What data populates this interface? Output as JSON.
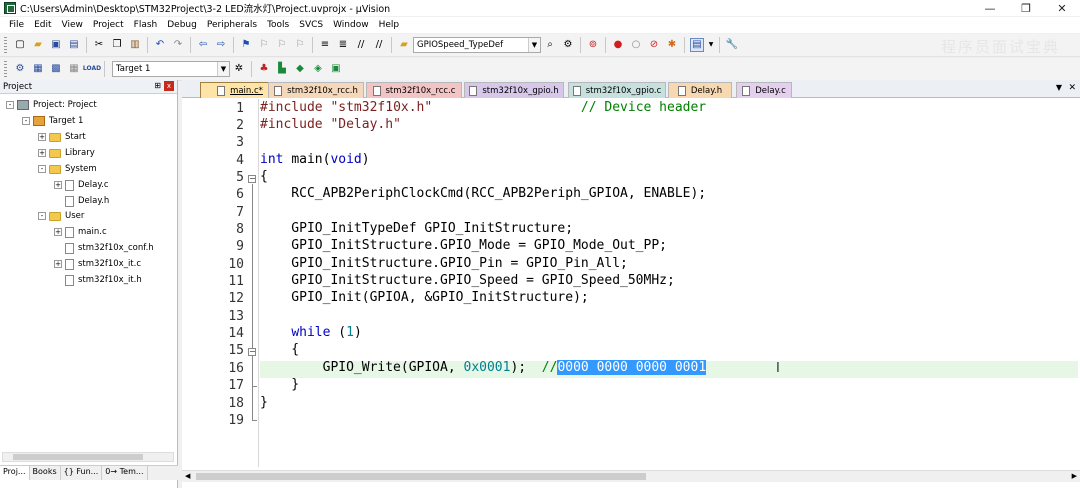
{
  "window": {
    "title": "C:\\Users\\Admin\\Desktop\\STM32Project\\3-2 LED流水灯\\Project.uvprojx - µVision",
    "minimize": "—",
    "restore": "❐",
    "close": "✕"
  },
  "menu": [
    "File",
    "Edit",
    "View",
    "Project",
    "Flash",
    "Debug",
    "Peripherals",
    "Tools",
    "SVCS",
    "Window",
    "Help"
  ],
  "toolbar1": {
    "find_combo": "GPIOSpeed_TypeDef",
    "icons": [
      "new-file-icon",
      "open-icon",
      "save-icon",
      "save-all-icon",
      "cut-icon",
      "copy-icon",
      "paste-icon",
      "undo-icon",
      "redo-icon",
      "nav-back-icon",
      "nav-forward-icon",
      "bookmark-icon",
      "bookmark-prev-icon",
      "bookmark-next-icon",
      "bookmark-clear-icon",
      "indent-icon",
      "unindent-icon",
      "comment-icon",
      "uncomment-icon",
      "find-in-files-icon",
      "debug-icon",
      "breakpoint-icon",
      "breakpoint-disable-icon",
      "breakpoint-disable-all-icon",
      "breakpoint-kill-all-icon",
      "window-layout-icon",
      "configure-icon"
    ]
  },
  "toolbar2": {
    "target_combo": "Target 1",
    "load_label": "LOAD"
  },
  "watermark": "程序员面试宝典",
  "project_panel": {
    "title": "Project",
    "pin": "📌",
    "close": "x",
    "tree": [
      {
        "label": "Project: Project",
        "level": 0,
        "type": "project",
        "expander": "-"
      },
      {
        "label": "Target 1",
        "level": 1,
        "type": "target",
        "expander": "-"
      },
      {
        "label": "Start",
        "level": 2,
        "type": "folder",
        "expander": "+"
      },
      {
        "label": "Library",
        "level": 2,
        "type": "folder",
        "expander": "+"
      },
      {
        "label": "System",
        "level": 2,
        "type": "folder",
        "expander": "-"
      },
      {
        "label": "Delay.c",
        "level": 3,
        "type": "file",
        "expander": "+"
      },
      {
        "label": "Delay.h",
        "level": 3,
        "type": "file",
        "expander": ""
      },
      {
        "label": "User",
        "level": 2,
        "type": "folder",
        "expander": "-"
      },
      {
        "label": "main.c",
        "level": 3,
        "type": "file",
        "expander": "+"
      },
      {
        "label": "stm32f10x_conf.h",
        "level": 3,
        "type": "file",
        "expander": ""
      },
      {
        "label": "stm32f10x_it.c",
        "level": 3,
        "type": "file",
        "expander": "+"
      },
      {
        "label": "stm32f10x_it.h",
        "level": 3,
        "type": "file",
        "expander": ""
      }
    ],
    "bottom_tabs": [
      "Proj...",
      "Books",
      "{} Fun...",
      "0→ Tem..."
    ]
  },
  "editor": {
    "tabs": [
      {
        "label": "main.c*",
        "color": "#ffe4a8",
        "active": true
      },
      {
        "label": "stm32f10x_rcc.h",
        "color": "#f5d7b9",
        "active": false
      },
      {
        "label": "stm32f10x_rcc.c",
        "color": "#f2c4c4",
        "active": false
      },
      {
        "label": "stm32f10x_gpio.h",
        "color": "#d7c7ea",
        "active": false
      },
      {
        "label": "stm32f10x_gpio.c",
        "color": "#c6e0dd",
        "active": false
      },
      {
        "label": "Delay.h",
        "color": "#f7d8b0",
        "active": false
      },
      {
        "label": "Delay.c",
        "color": "#e4d0ee",
        "active": false
      }
    ],
    "tab_menu": "▼",
    "tab_close": "✕",
    "line_numbers": [
      "1",
      "2",
      "3",
      "4",
      "5",
      "6",
      "7",
      "8",
      "9",
      "10",
      "11",
      "12",
      "13",
      "14",
      "15",
      "16",
      "17",
      "18",
      "19"
    ],
    "code": {
      "l1a": "#include ",
      "l1b": "\"stm32f10x.h\"",
      "l1c": "                   // Device header",
      "l2a": "#include ",
      "l2b": "\"Delay.h\"",
      "l4a": "int ",
      "l4b": "main(",
      "l4c": "void",
      "l4d": ")",
      "l5": "{",
      "l6": "    RCC_APB2PeriphClockCmd(RCC_APB2Periph_GPIOA, ENABLE);",
      "l8": "    GPIO_InitTypeDef GPIO_InitStructure;",
      "l9": "    GPIO_InitStructure.GPIO_Mode = GPIO_Mode_Out_PP;",
      "l10": "    GPIO_InitStructure.GPIO_Pin = GPIO_Pin_All;",
      "l11": "    GPIO_InitStructure.GPIO_Speed = GPIO_Speed_50MHz;",
      "l12": "    GPIO_Init(GPIOA, &GPIO_InitStructure);",
      "l14a": "    ",
      "l14b": "while ",
      "l14c": "(",
      "l14d": "1",
      "l14e": ")",
      "l15": "    {",
      "l16a": "        GPIO_Write(GPIOA, ",
      "l16b": "0x0001",
      "l16c": ");  ",
      "l16d": "//",
      "l16e": "0000 0000 0000 0001",
      "l17": "    }",
      "l18": "}"
    },
    "cursor": "I"
  }
}
